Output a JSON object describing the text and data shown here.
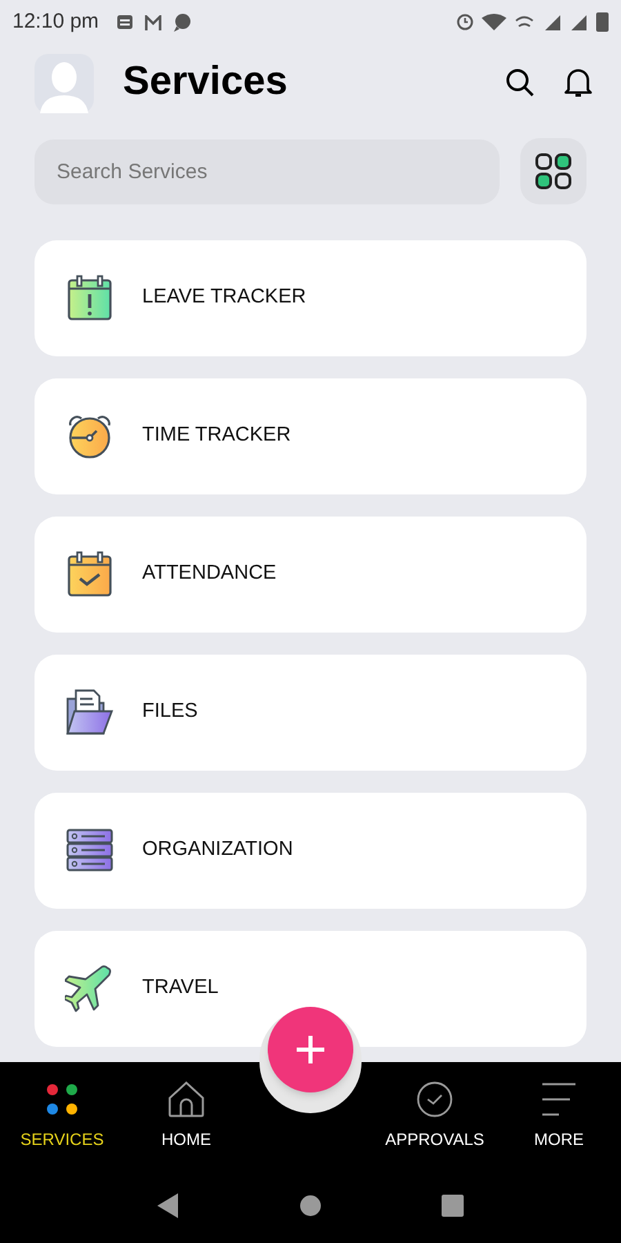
{
  "status_bar": {
    "time": "12:10 pm"
  },
  "header": {
    "title": "Services"
  },
  "search": {
    "placeholder": "Search Services"
  },
  "services": [
    {
      "label": "LEAVE TRACKER",
      "kind": "leave"
    },
    {
      "label": "TIME TRACKER",
      "kind": "time"
    },
    {
      "label": "ATTENDANCE",
      "kind": "attendance"
    },
    {
      "label": "FILES",
      "kind": "files"
    },
    {
      "label": "ORGANIZATION",
      "kind": "organization"
    },
    {
      "label": "TRAVEL",
      "kind": "travel"
    }
  ],
  "bottom_nav": [
    {
      "label": "SERVICES",
      "kind": "services",
      "selected": true
    },
    {
      "label": "HOME",
      "kind": "home",
      "selected": false
    },
    {
      "label": "APPROVALS",
      "kind": "approvals",
      "selected": false
    },
    {
      "label": "MORE",
      "kind": "more",
      "selected": false
    }
  ]
}
